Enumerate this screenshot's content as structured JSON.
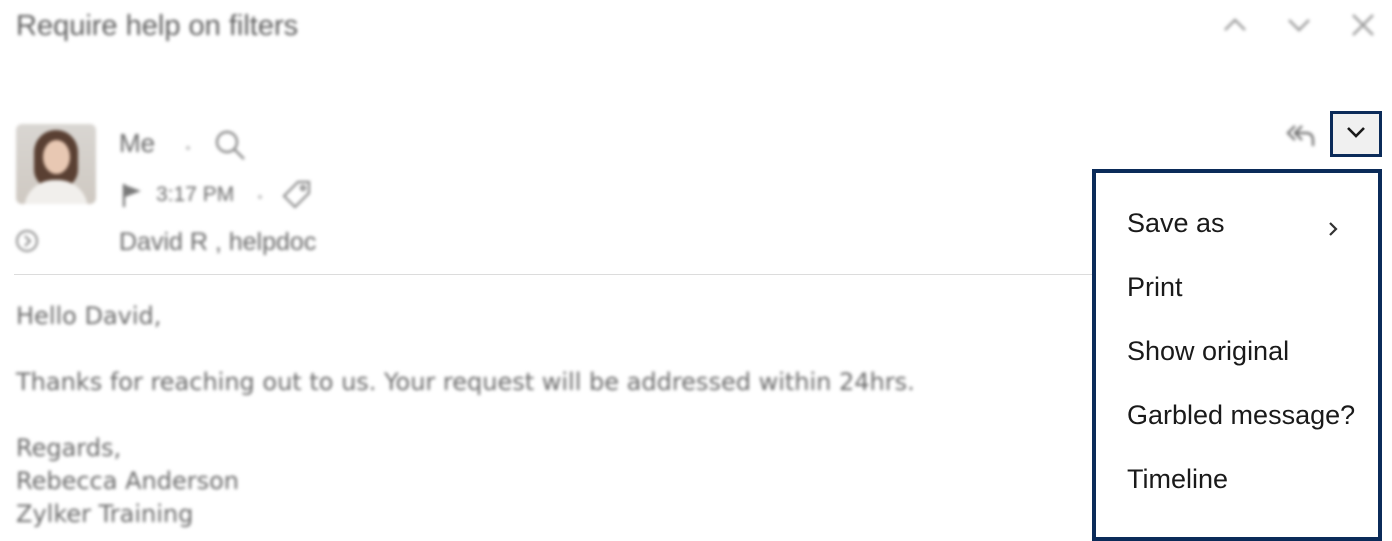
{
  "header": {
    "subject": "Require help on filters",
    "nav_icons": [
      "chevron-up-icon",
      "chevron-down-icon",
      "close-icon"
    ]
  },
  "message": {
    "sender": "Me",
    "time": "3:17 PM",
    "recipients": "David R , helpdoc",
    "body": {
      "greeting": "Hello David,",
      "line1": "Thanks for reaching out to us. Your request will be addressed within 24hrs.",
      "closing": "Regards,",
      "name": "Rebecca Anderson",
      "company": "Zylker Training"
    }
  },
  "menu": {
    "items": [
      {
        "label": "Save as",
        "has_submenu": true
      },
      {
        "label": "Print"
      },
      {
        "label": "Show original"
      },
      {
        "label": "Garbled message?"
      },
      {
        "label": "Timeline"
      }
    ]
  },
  "colors": {
    "highlight_border": "#0b2b59",
    "muted_text": "#6a6a6a"
  }
}
